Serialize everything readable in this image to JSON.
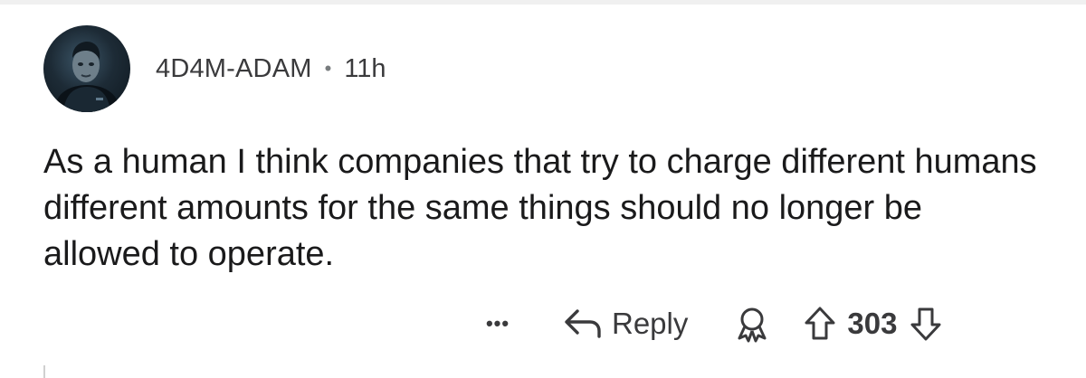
{
  "comment": {
    "author": "4D4M-ADAM",
    "separator": "•",
    "age": "11h",
    "body": "As a human I think companies that try to charge different humans different amounts for the same things should no longer be allowed to operate."
  },
  "actions": {
    "more_label": "•••",
    "reply_label": "Reply",
    "vote_count": "303"
  },
  "icons": {
    "avatar": "user-avatar",
    "reply": "reply-arrow-icon",
    "award": "award-icon",
    "upvote": "upvote-arrow-icon",
    "downvote": "downvote-arrow-icon"
  },
  "colors": {
    "text": "#1a1a1b",
    "meta": "#3a3a3c",
    "background": "#ffffff"
  }
}
